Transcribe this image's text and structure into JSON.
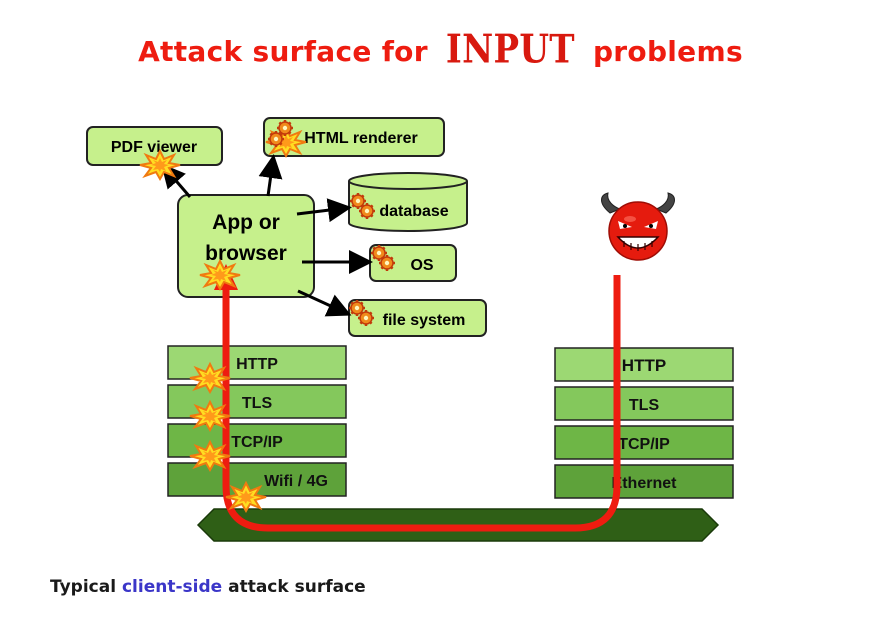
{
  "title": {
    "before": "Attack surface for",
    "emph": "INPUT",
    "after": "problems"
  },
  "apps": {
    "pdf_viewer": "PDF viewer",
    "html_renderer": "HTML renderer",
    "app_line1": "App or",
    "app_line2": "browser",
    "database": "database",
    "os": "OS",
    "file_system": "file system"
  },
  "client_stack": [
    "HTTP",
    "TLS",
    "TCP/IP",
    "Wifi / 4G"
  ],
  "server_stack": [
    "HTTP",
    "TLS",
    "TCP/IP",
    "Ethernet"
  ],
  "caption": {
    "before": "Typical",
    "emph": "client-side",
    "after": "attack surface"
  },
  "colors": {
    "title": "#ee1c10",
    "box_light": "#c6f08c",
    "layer_http": "#9cd873",
    "layer_tls": "#84c85c",
    "layer_tcp": "#6eb646",
    "layer_link": "#5ea23a",
    "arrow": "#ee1c10",
    "network": "#2f5f16",
    "caption_highlight": "#3b36c8",
    "burst": "#ffdd22"
  },
  "icons": [
    "burst-icon",
    "gear-icon",
    "devil-icon"
  ]
}
